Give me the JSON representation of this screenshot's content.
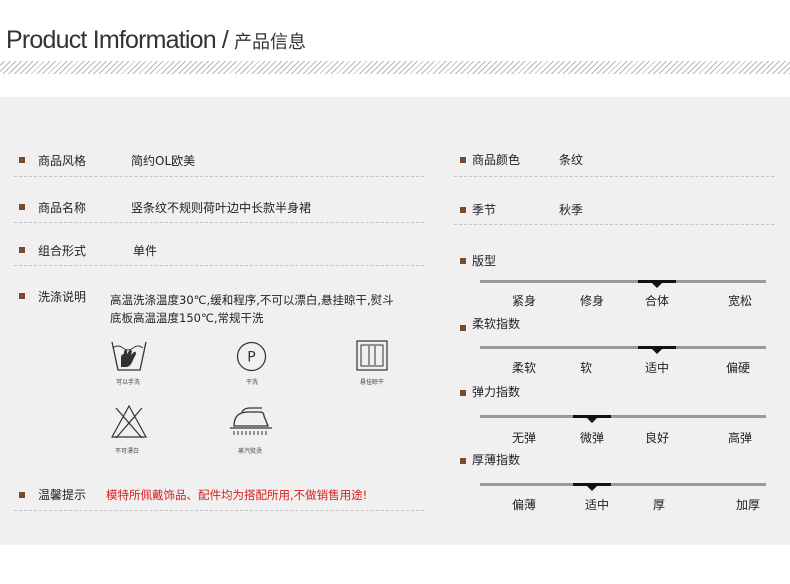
{
  "header": {
    "title_en": "Product Imformation",
    "separator": "/",
    "title_cn": "产品信息"
  },
  "colors": {
    "bullet": "#7b4a2a",
    "warning": "#d81e1e",
    "panel": "#f0f0f0"
  },
  "info": {
    "style": {
      "label": "商品风格",
      "value": "简约OL欧美"
    },
    "name": {
      "label": "商品名称",
      "value": "竖条纹不规则荷叶边中长款半身裙"
    },
    "combo": {
      "label": "组合形式",
      "value": "单件"
    },
    "wash": {
      "label": "洗涤说明",
      "line1": "高温洗涤温度30℃,缓和程序,不可以漂白,悬挂晾干,熨斗",
      "line2": "底板高温温度150℃,常规干洗"
    },
    "notice": {
      "label": "温馨提示",
      "value": "模特所佩戴饰品、配件均为搭配所用,不做销售用途!"
    },
    "color": {
      "label": "商品颜色",
      "value": "条纹"
    },
    "season": {
      "label": "季节",
      "value": "秋季"
    }
  },
  "care_icons": [
    {
      "name": "hand-wash-icon",
      "caption": "可以手洗"
    },
    {
      "name": "dry-clean-p-icon",
      "caption": "干洗"
    },
    {
      "name": "hang-dry-icon",
      "caption": "悬挂晾干"
    },
    {
      "name": "no-bleach-icon",
      "caption": "不可漂白"
    },
    {
      "name": "steam-iron-icon",
      "caption": "蒸汽熨烫"
    }
  ],
  "scales": [
    {
      "title": "版型",
      "options": [
        "紧身",
        "修身",
        "合体",
        "宽松"
      ],
      "selected": 2
    },
    {
      "title": "柔软指数",
      "options": [
        "柔软",
        "软",
        "适中",
        "偏硬"
      ],
      "selected": 2
    },
    {
      "title": "弹力指数",
      "options": [
        "无弹",
        "微弹",
        "良好",
        "高弹"
      ],
      "selected": 1
    },
    {
      "title": "厚薄指数",
      "options": [
        "偏薄",
        "适中",
        "厚",
        "加厚"
      ],
      "selected": 1
    }
  ]
}
